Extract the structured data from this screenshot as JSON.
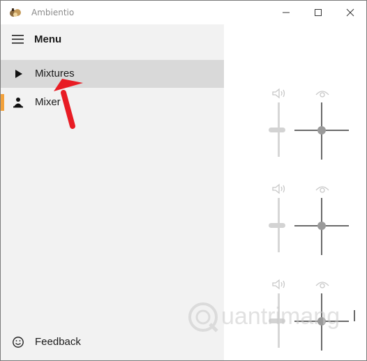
{
  "window": {
    "title": "Ambientio"
  },
  "sidebar": {
    "menu_label": "Menu",
    "items": [
      {
        "label": "Mixtures",
        "icon": "play-icon",
        "selected": true
      },
      {
        "label": "Mixer",
        "icon": "mixer-icon",
        "active": true
      },
      {
        "label": "Feedback",
        "icon": "smiley-icon"
      }
    ]
  },
  "mixer": {
    "channels": [
      {
        "volume_icon": "speaker-icon",
        "visibility_icon": "eye-icon"
      },
      {
        "volume_icon": "speaker-icon",
        "visibility_icon": "eye-icon"
      },
      {
        "volume_icon": "speaker-icon",
        "visibility_icon": "eye-icon"
      }
    ]
  },
  "watermark": {
    "text": "uantrimang"
  },
  "colors": {
    "sidebar_bg": "#f2f2f2",
    "selected_bg": "#d9d9d9",
    "active_indicator": "#f2a13b",
    "annotation_red": "#e81c24"
  }
}
